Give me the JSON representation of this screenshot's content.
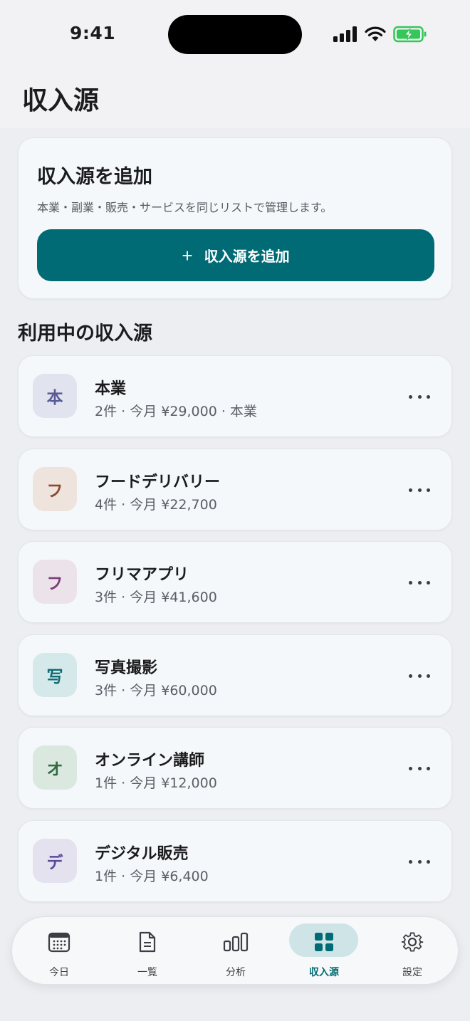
{
  "status": {
    "time": "9:41"
  },
  "header": {
    "title": "収入源"
  },
  "add_card": {
    "title": "収入源を追加",
    "description": "本業・副業・販売・サービスを同じリストで管理します。",
    "button_plus": "+",
    "button_label": "収入源を追加"
  },
  "section": {
    "title": "利用中の収入源"
  },
  "sources": [
    {
      "initial": "本",
      "name": "本業",
      "meta": "2件 · 今月 ¥29,000 · 本業",
      "icon_bg": "#e1e4ee",
      "icon_fg": "#5a5a96"
    },
    {
      "initial": "フ",
      "name": "フードデリバリー",
      "meta": "4件 · 今月 ¥22,700",
      "icon_bg": "#eee3dd",
      "icon_fg": "#8a4a30"
    },
    {
      "initial": "フ",
      "name": "フリマアプリ",
      "meta": "3件 · 今月 ¥41,600",
      "icon_bg": "#ebe2ea",
      "icon_fg": "#7a3f78"
    },
    {
      "initial": "写",
      "name": "写真撮影",
      "meta": "3件 · 今月 ¥60,000",
      "icon_bg": "#d5e8ea",
      "icon_fg": "#0e6b72"
    },
    {
      "initial": "オ",
      "name": "オンライン講師",
      "meta": "1件 · 今月 ¥12,000",
      "icon_bg": "#dbe8df",
      "icon_fg": "#2f6a42"
    },
    {
      "initial": "デ",
      "name": "デジタル販売",
      "meta": "1件 · 今月 ¥6,400",
      "icon_bg": "#e5e2ef",
      "icon_fg": "#5a4a9a"
    }
  ],
  "tabs": [
    {
      "label": "今日",
      "icon": "calendar-icon"
    },
    {
      "label": "一覧",
      "icon": "document-icon"
    },
    {
      "label": "分析",
      "icon": "bar-chart-icon"
    },
    {
      "label": "収入源",
      "icon": "grid-icon",
      "active": true
    },
    {
      "label": "設定",
      "icon": "gear-icon"
    }
  ],
  "colors": {
    "accent": "#006b74",
    "battery": "#34c759"
  }
}
